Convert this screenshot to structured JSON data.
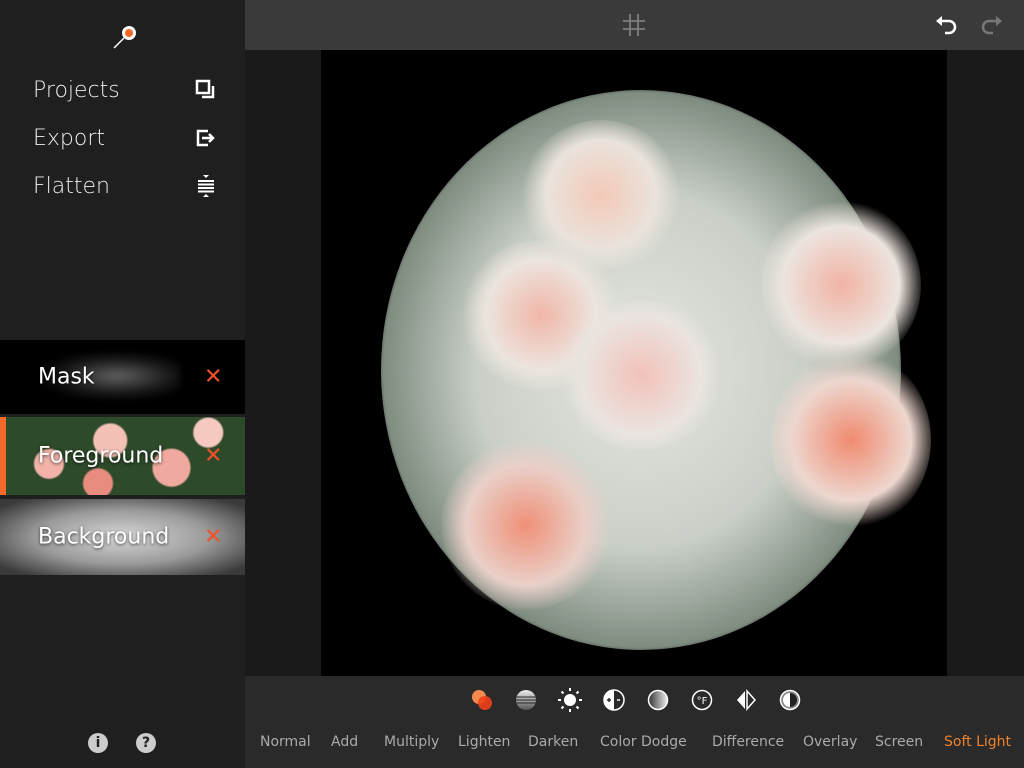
{
  "sidebar": {
    "menu": [
      {
        "label": "Projects",
        "icon": "projects-icon"
      },
      {
        "label": "Export",
        "icon": "export-icon"
      },
      {
        "label": "Flatten",
        "icon": "flatten-icon"
      }
    ],
    "layers": [
      {
        "name": "Mask",
        "selected": false
      },
      {
        "name": "Foreground",
        "selected": true
      },
      {
        "name": "Background",
        "selected": false
      }
    ],
    "delete_glyph": "✕",
    "info_glyph": "i",
    "help_glyph": "?"
  },
  "toolbar": {
    "icons": [
      "grid-icon",
      "undo-icon",
      "redo-icon"
    ]
  },
  "tools": [
    "blend-icon",
    "opacity-icon",
    "brightness-icon",
    "exposure-icon",
    "gradient-icon",
    "temperature-icon",
    "flip-icon",
    "contrast-icon"
  ],
  "blend_modes": [
    "Normal",
    "Add",
    "Multiply",
    "Lighten",
    "Darken",
    "Color Dodge",
    "Difference",
    "Overlay",
    "Screen",
    "Soft Light"
  ],
  "active_blend_mode": "Soft Light",
  "colors": {
    "accent": "#f26a2a",
    "active_mode": "#f0822a",
    "delete": "#f0502a"
  }
}
